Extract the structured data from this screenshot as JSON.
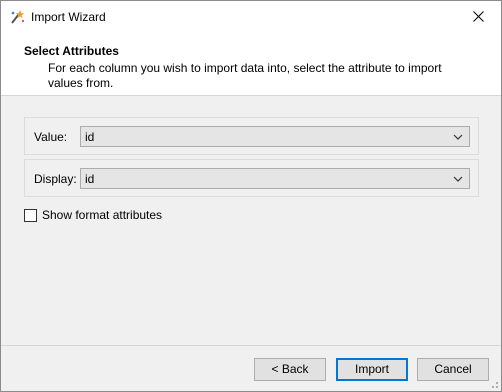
{
  "window": {
    "title": "Import Wizard",
    "app_icon": "wizard-wand-icon",
    "close_icon": "close-icon"
  },
  "header": {
    "title": "Select Attributes",
    "description": "For each column you wish to import data into, select the attribute to import values from."
  },
  "fields": {
    "value": {
      "label": "Value:",
      "selected": "id"
    },
    "display": {
      "label": "Display:",
      "selected": "id"
    }
  },
  "show_format": {
    "label": "Show format attributes",
    "checked": false
  },
  "buttons": {
    "back": "< Back",
    "import": "Import",
    "cancel": "Cancel"
  },
  "colors": {
    "accent": "#0078d7",
    "window_bg": "#f0f0f0",
    "header_bg": "#ffffff"
  }
}
